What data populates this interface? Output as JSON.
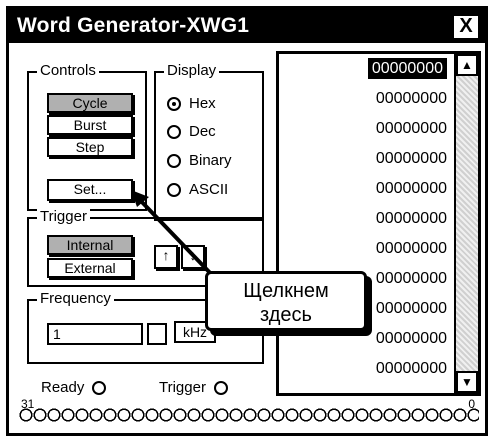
{
  "window": {
    "title": "Word Generator-XWG1",
    "close_label": "X"
  },
  "controls": {
    "title": "Controls",
    "buttons": [
      "Cycle",
      "Burst",
      "Step"
    ],
    "set_label": "Set..."
  },
  "display": {
    "title": "Display",
    "options": [
      "Hex",
      "Dec",
      "Binary",
      "ASCII"
    ],
    "selected": "Hex"
  },
  "trigger": {
    "title": "Trigger",
    "buttons": [
      "Internal",
      "External"
    ],
    "edge_rise_label": "↑",
    "edge_fall_label": "↓"
  },
  "frequency": {
    "title": "Frequency",
    "value": "1",
    "unit": "kHz"
  },
  "words": [
    "00000000",
    "00000000",
    "00000000",
    "00000000",
    "00000000",
    "00000000",
    "00000000",
    "00000000",
    "00000000",
    "00000000",
    "00000000"
  ],
  "status": {
    "ready_label": "Ready",
    "trigger_label": "Trigger"
  },
  "bits": {
    "msb_label": "31",
    "lsb_label": "0"
  },
  "callout": {
    "line1": "Щелкнем",
    "line2": "здесь"
  }
}
